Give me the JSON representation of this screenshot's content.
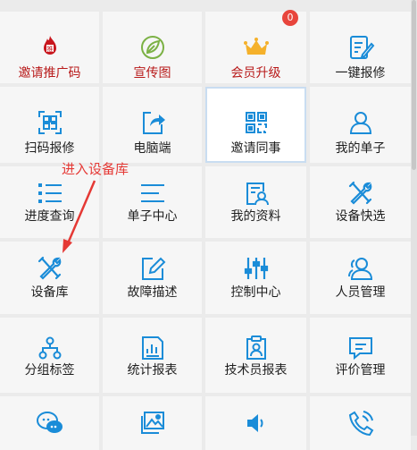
{
  "colors": {
    "accent_blue": "#1a8cd8",
    "brand_red": "#b81a1a",
    "annotation_red": "#e53935",
    "badge_red": "#e8453c"
  },
  "grid": {
    "row1": [
      {
        "label": "邀请推广码",
        "icon": "fire-badge-icon",
        "label_color": "red"
      },
      {
        "label": "宣传图",
        "icon": "leaf-icon",
        "label_color": "red"
      },
      {
        "label": "会员升级",
        "icon": "crown-icon",
        "label_color": "red"
      },
      {
        "label": "一键报修",
        "icon": "form-edit-icon",
        "label_color": "dark"
      }
    ],
    "row2": [
      {
        "label": "扫码报修",
        "icon": "qr-scan-icon",
        "label_color": "dark"
      },
      {
        "label": "电脑端",
        "icon": "share-arrow-icon",
        "label_color": "dark"
      },
      {
        "label": "邀请同事",
        "icon": "qr-code-icon",
        "label_color": "dark"
      },
      {
        "label": "我的单子",
        "icon": "user-icon",
        "label_color": "dark"
      }
    ],
    "row3": [
      {
        "label": "进度查询",
        "icon": "list-icon",
        "label_color": "dark"
      },
      {
        "label": "单子中心",
        "icon": "lines-icon",
        "label_color": "dark"
      },
      {
        "label": "我的资料",
        "icon": "profile-doc-icon",
        "label_color": "dark"
      },
      {
        "label": "设备快选",
        "icon": "tools-icon",
        "label_color": "dark"
      }
    ],
    "row4": [
      {
        "label": "设备库",
        "icon": "tools-icon",
        "label_color": "dark"
      },
      {
        "label": "故障描述",
        "icon": "pencil-box-icon",
        "label_color": "dark"
      },
      {
        "label": "控制中心",
        "icon": "sliders-icon",
        "label_color": "dark"
      },
      {
        "label": "人员管理",
        "icon": "people-icon",
        "label_color": "dark"
      }
    ],
    "row5": [
      {
        "label": "分组标签",
        "icon": "hierarchy-icon",
        "label_color": "dark"
      },
      {
        "label": "统计报表",
        "icon": "chart-doc-icon",
        "label_color": "dark"
      },
      {
        "label": "技术员报表",
        "icon": "clipboard-user-icon",
        "label_color": "dark"
      },
      {
        "label": "评价管理",
        "icon": "comment-icon",
        "label_color": "dark"
      }
    ],
    "row6": [
      {
        "label": "",
        "icon": "chat-bubbles-icon",
        "label_color": "dark"
      },
      {
        "label": "",
        "icon": "gallery-icon",
        "label_color": "dark"
      },
      {
        "label": "",
        "icon": "speaker-icon",
        "label_color": "dark"
      },
      {
        "label": "",
        "icon": "phone-icon",
        "label_color": "dark"
      }
    ]
  },
  "badge": {
    "count": "0"
  },
  "annotation": {
    "text": "进入设备库"
  }
}
